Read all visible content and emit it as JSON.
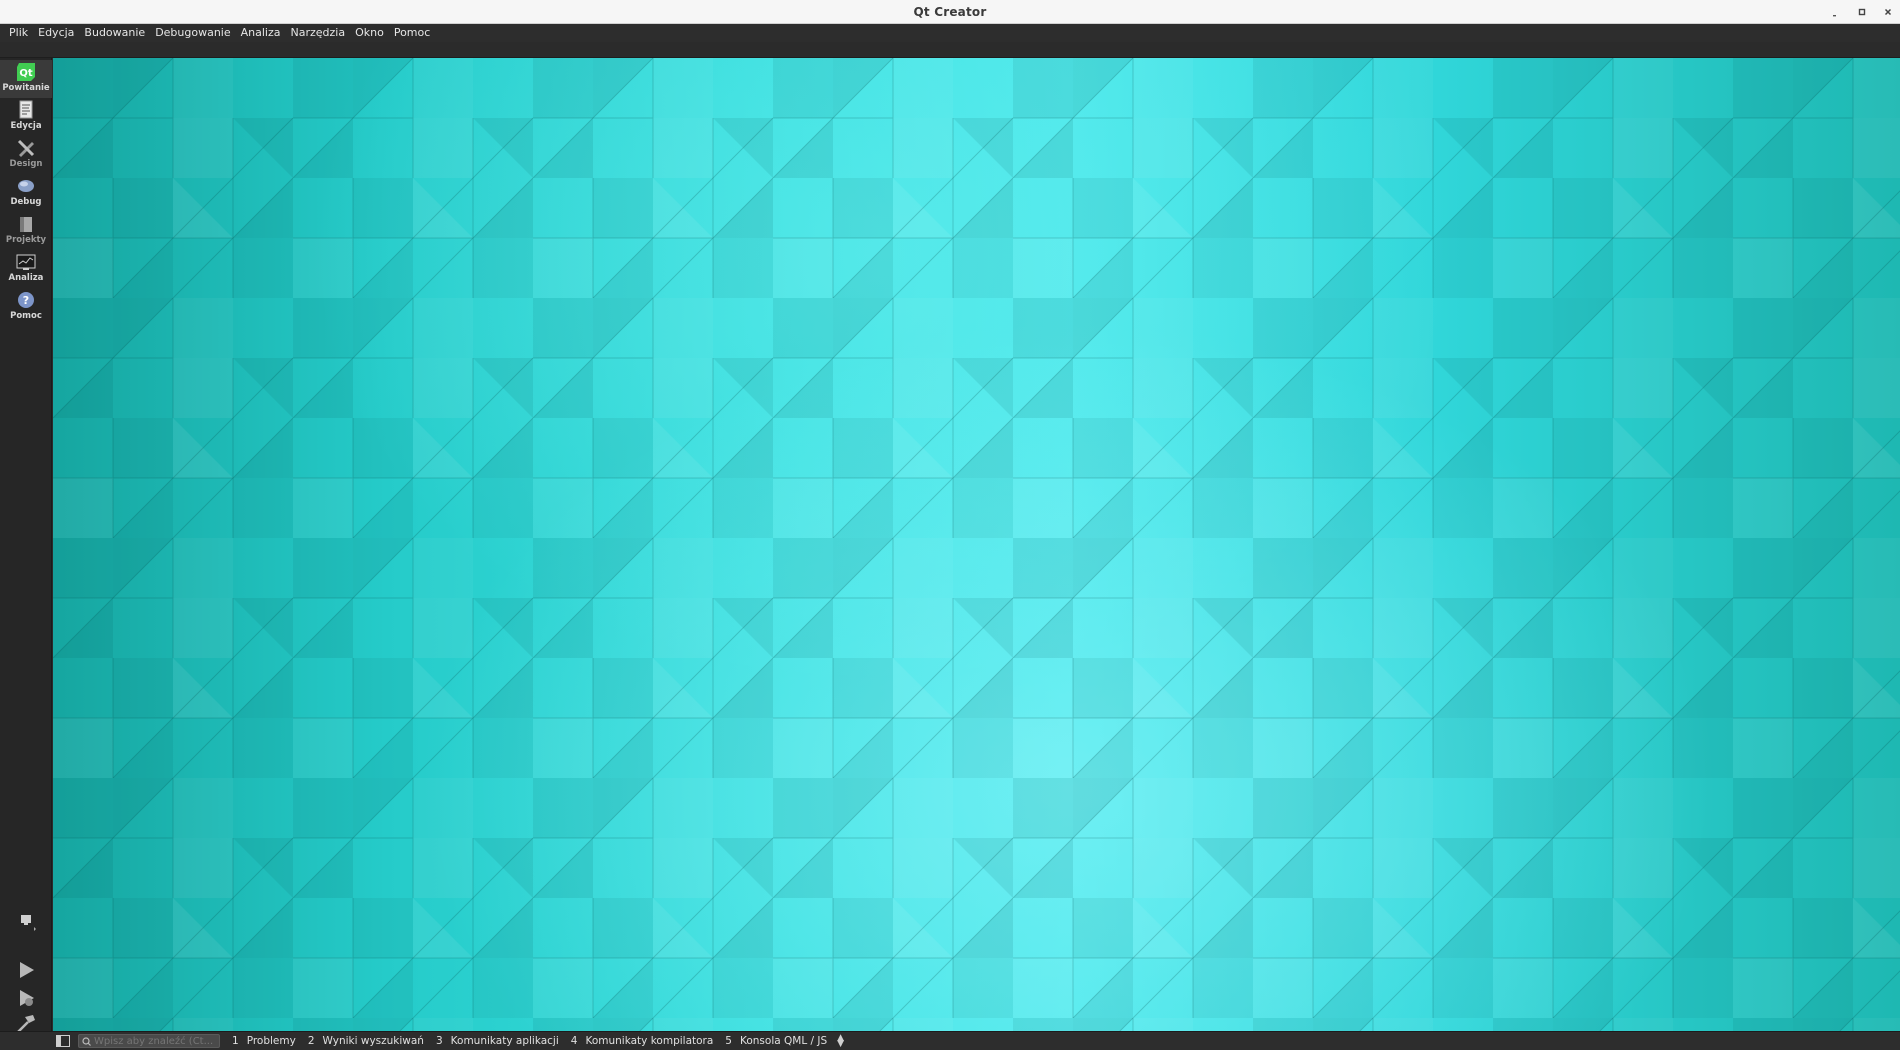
{
  "window": {
    "title": "Qt Creator",
    "controls": [
      "minimize",
      "maximize",
      "close"
    ]
  },
  "menubar": {
    "items": [
      {
        "label": "Plik"
      },
      {
        "label": "Edycja"
      },
      {
        "label": "Budowanie"
      },
      {
        "label": "Debugowanie"
      },
      {
        "label": "Analiza"
      },
      {
        "label": "Narzędzia"
      },
      {
        "label": "Okno"
      },
      {
        "label": "Pomoc"
      }
    ]
  },
  "modes": [
    {
      "label": "Powitanie",
      "icon": "qt-logo-icon",
      "active": true
    },
    {
      "label": "Edycja",
      "icon": "document-edit-icon",
      "active": false
    },
    {
      "label": "Design",
      "icon": "pencil-ruler-icon",
      "active": false
    },
    {
      "label": "Debug",
      "icon": "bug-icon",
      "active": false
    },
    {
      "label": "Projekty",
      "icon": "folder-wrench-icon",
      "active": false
    },
    {
      "label": "Analiza",
      "icon": "monitor-chart-icon",
      "active": false
    },
    {
      "label": "Pomoc",
      "icon": "question-icon",
      "active": false
    }
  ],
  "tools": {
    "target_selector": "monitor-target-icon",
    "run": "play-icon",
    "debug": "play-bug-icon",
    "build": "hammer-icon"
  },
  "statusbar": {
    "locator_placeholder": "Wpisz aby znaleźć (Ct...",
    "panes": [
      {
        "num": "1",
        "label": "Problemy"
      },
      {
        "num": "2",
        "label": "Wyniki wyszukiwań"
      },
      {
        "num": "3",
        "label": "Komunikaty aplikacji"
      },
      {
        "num": "4",
        "label": "Komunikaty kompilatora"
      },
      {
        "num": "5",
        "label": "Konsola QML / JS"
      }
    ]
  },
  "colors": {
    "sidebar_bg": "#262626",
    "wallpaper_light": "#4be8eb",
    "wallpaper_dark": "#16a6a0",
    "qt_green": "#41cd52"
  }
}
